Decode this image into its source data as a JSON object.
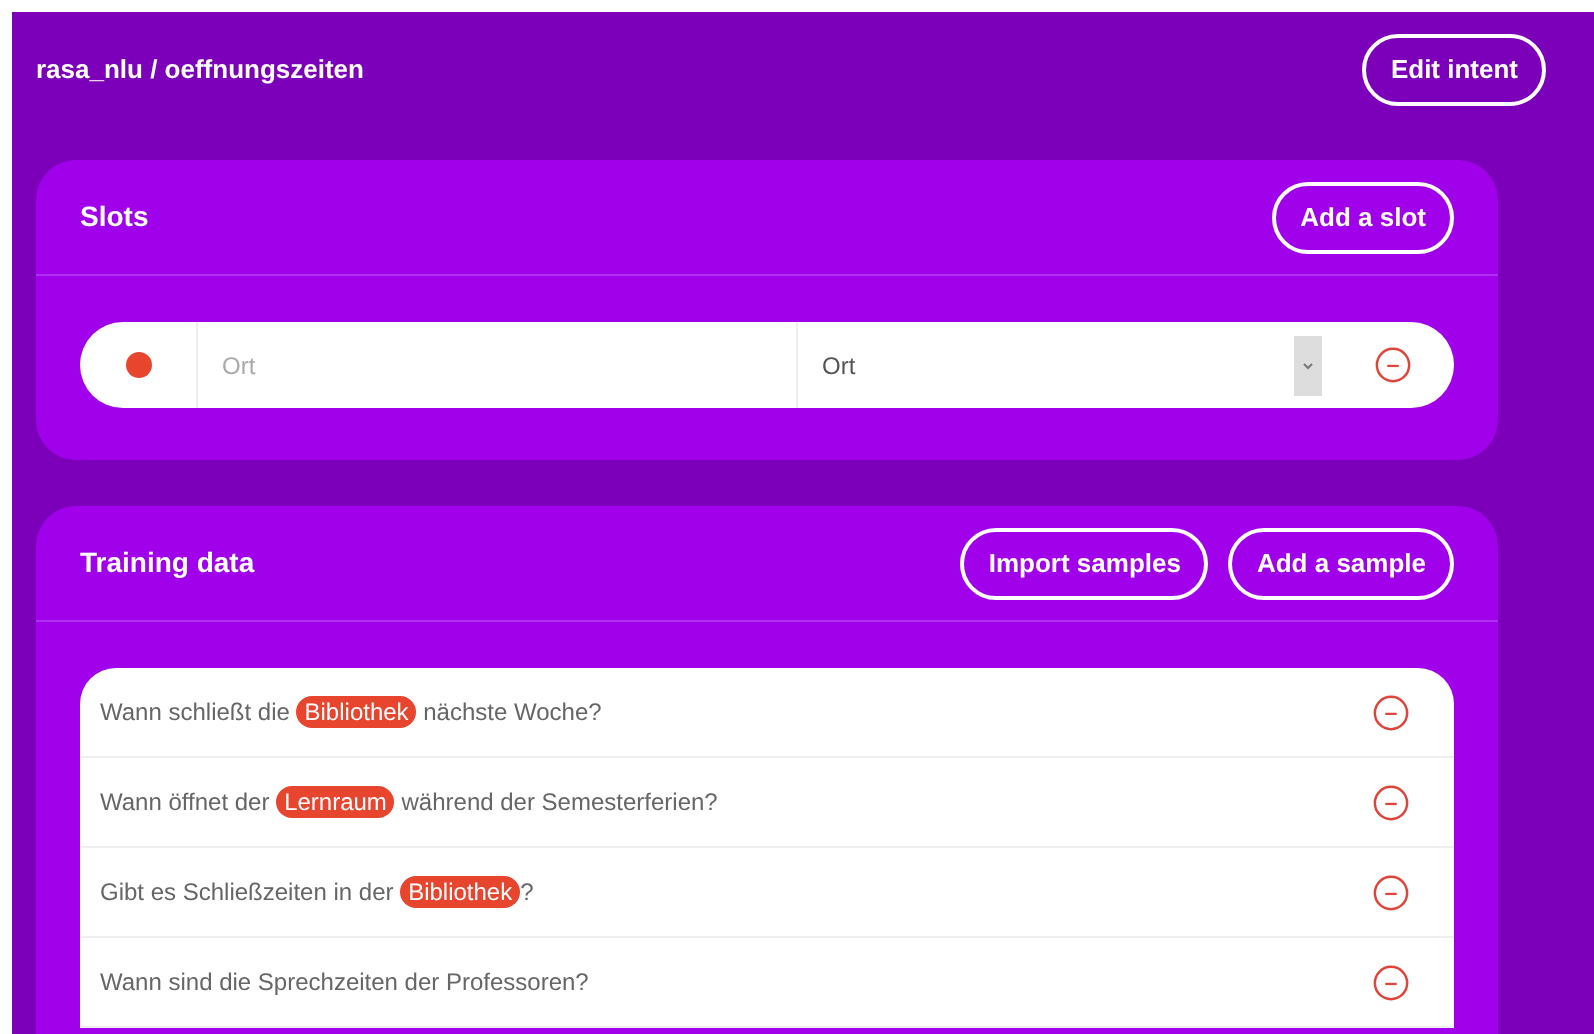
{
  "header": {
    "breadcrumb": "rasa_nlu / oeffnungszeiten",
    "edit_button": "Edit intent"
  },
  "slots": {
    "title": "Slots",
    "add_button": "Add a slot",
    "items": [
      {
        "color": "#e8452f",
        "name": "Ort",
        "entity": "Ort"
      }
    ]
  },
  "training_data": {
    "title": "Training data",
    "buttons": [
      "Import samples",
      "Add a sample"
    ],
    "samples": [
      {
        "parts": [
          {
            "kind": "text",
            "text": "Wann schließt die "
          },
          {
            "kind": "entity",
            "text": "Bibliothek"
          },
          {
            "kind": "text",
            "text": " nächste Woche?"
          }
        ]
      },
      {
        "parts": [
          {
            "kind": "text",
            "text": "Wann öffnet der "
          },
          {
            "kind": "entity",
            "text": "Lernraum"
          },
          {
            "kind": "text",
            "text": " während der Semesterferien?"
          }
        ]
      },
      {
        "parts": [
          {
            "kind": "text",
            "text": "Gibt es Schließzeiten in der "
          },
          {
            "kind": "entity",
            "text": "Bibliothek"
          },
          {
            "kind": "text",
            "text": "?"
          }
        ]
      },
      {
        "parts": [
          {
            "kind": "text",
            "text": "Wann sind die Sprechzeiten der Professoren?"
          }
        ]
      }
    ]
  }
}
